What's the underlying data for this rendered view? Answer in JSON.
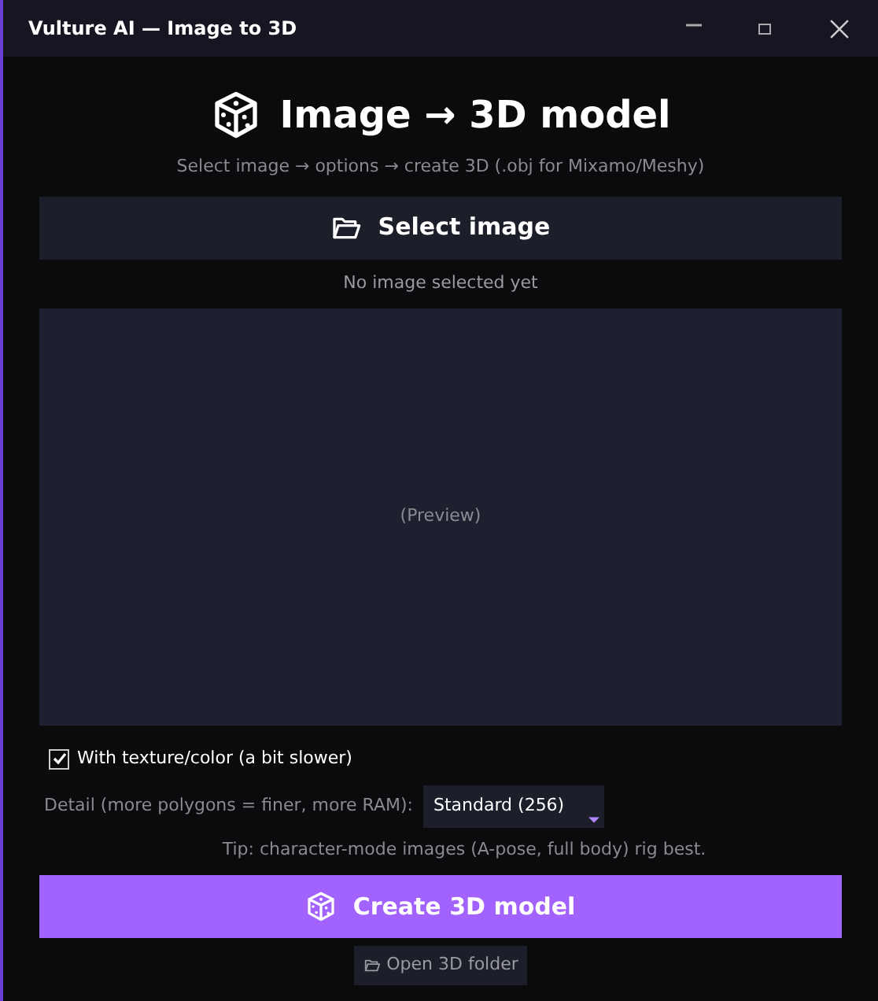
{
  "window": {
    "title": "Vulture AI — Image to 3D"
  },
  "header": {
    "title": "Image → 3D model",
    "subtitle": "Select image → options → create 3D (.obj for Mixamo/Meshy)"
  },
  "select_button": {
    "label": "Select image"
  },
  "status": "No image selected yet",
  "preview": {
    "caption": "(Preview)"
  },
  "texture_option": {
    "label": "With texture/color (a bit slower)",
    "checked": true
  },
  "detail": {
    "label": "Detail (more polygons = finer, more RAM):",
    "value": "Standard (256)"
  },
  "tip": "Tip: character-mode images (A-pose, full body) rig best.",
  "create_button": {
    "label": "Create 3D model"
  },
  "open_folder_button": {
    "label": "Open 3D folder"
  }
}
